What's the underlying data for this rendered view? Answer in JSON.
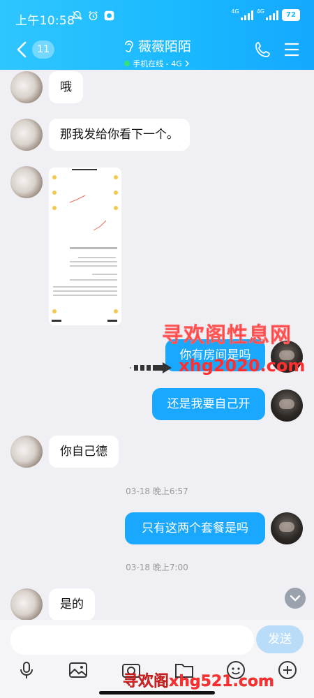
{
  "status_bar": {
    "time": "上午10:58",
    "net_1": "4G",
    "net_2": "4G",
    "battery": "72",
    "icons": [
      "mute-icon",
      "alarm-icon",
      "app-notification-icon"
    ]
  },
  "header": {
    "back_count": "11",
    "title": "薇薇陌陌",
    "subtitle": "手机在线 - 4G",
    "colors": {
      "start": "#2fc6ff",
      "end": "#14a8ff"
    },
    "icons": [
      "back-arrow-icon",
      "ear-icon",
      "phone-icon",
      "menu-icon"
    ]
  },
  "messages": [
    {
      "side": "left",
      "text": "哦"
    },
    {
      "side": "left",
      "text": "那我发给你看下一个。"
    },
    {
      "side": "left",
      "type": "image"
    },
    {
      "side": "right",
      "text": "你有房间是吗"
    },
    {
      "side": "right",
      "text": "还是我要自己开"
    },
    {
      "side": "left",
      "text": "你自己德"
    },
    {
      "type": "timestamp",
      "text": "03-18 晚上6:57"
    },
    {
      "side": "right",
      "text": "只有这两个套餐是吗"
    },
    {
      "type": "timestamp",
      "text": "03-18 晚上7:00"
    },
    {
      "side": "left",
      "text": "是的"
    }
  ],
  "watermarks": {
    "site_name": "寻欢阁性息网",
    "domain_1": "xhg2020.com",
    "bottom": "寻欢阁xhg521.com"
  },
  "input": {
    "placeholder": "",
    "send_label": "发送"
  },
  "toolbar": {
    "icons": [
      "microphone-icon",
      "image-icon",
      "camera-icon",
      "folder-icon",
      "emoji-icon",
      "plus-icon"
    ]
  },
  "colors": {
    "bubble_right": "#1aa8ff",
    "bubble_left": "#ffffff",
    "background": "#efeff4",
    "send_button": "#b9dcf8"
  }
}
